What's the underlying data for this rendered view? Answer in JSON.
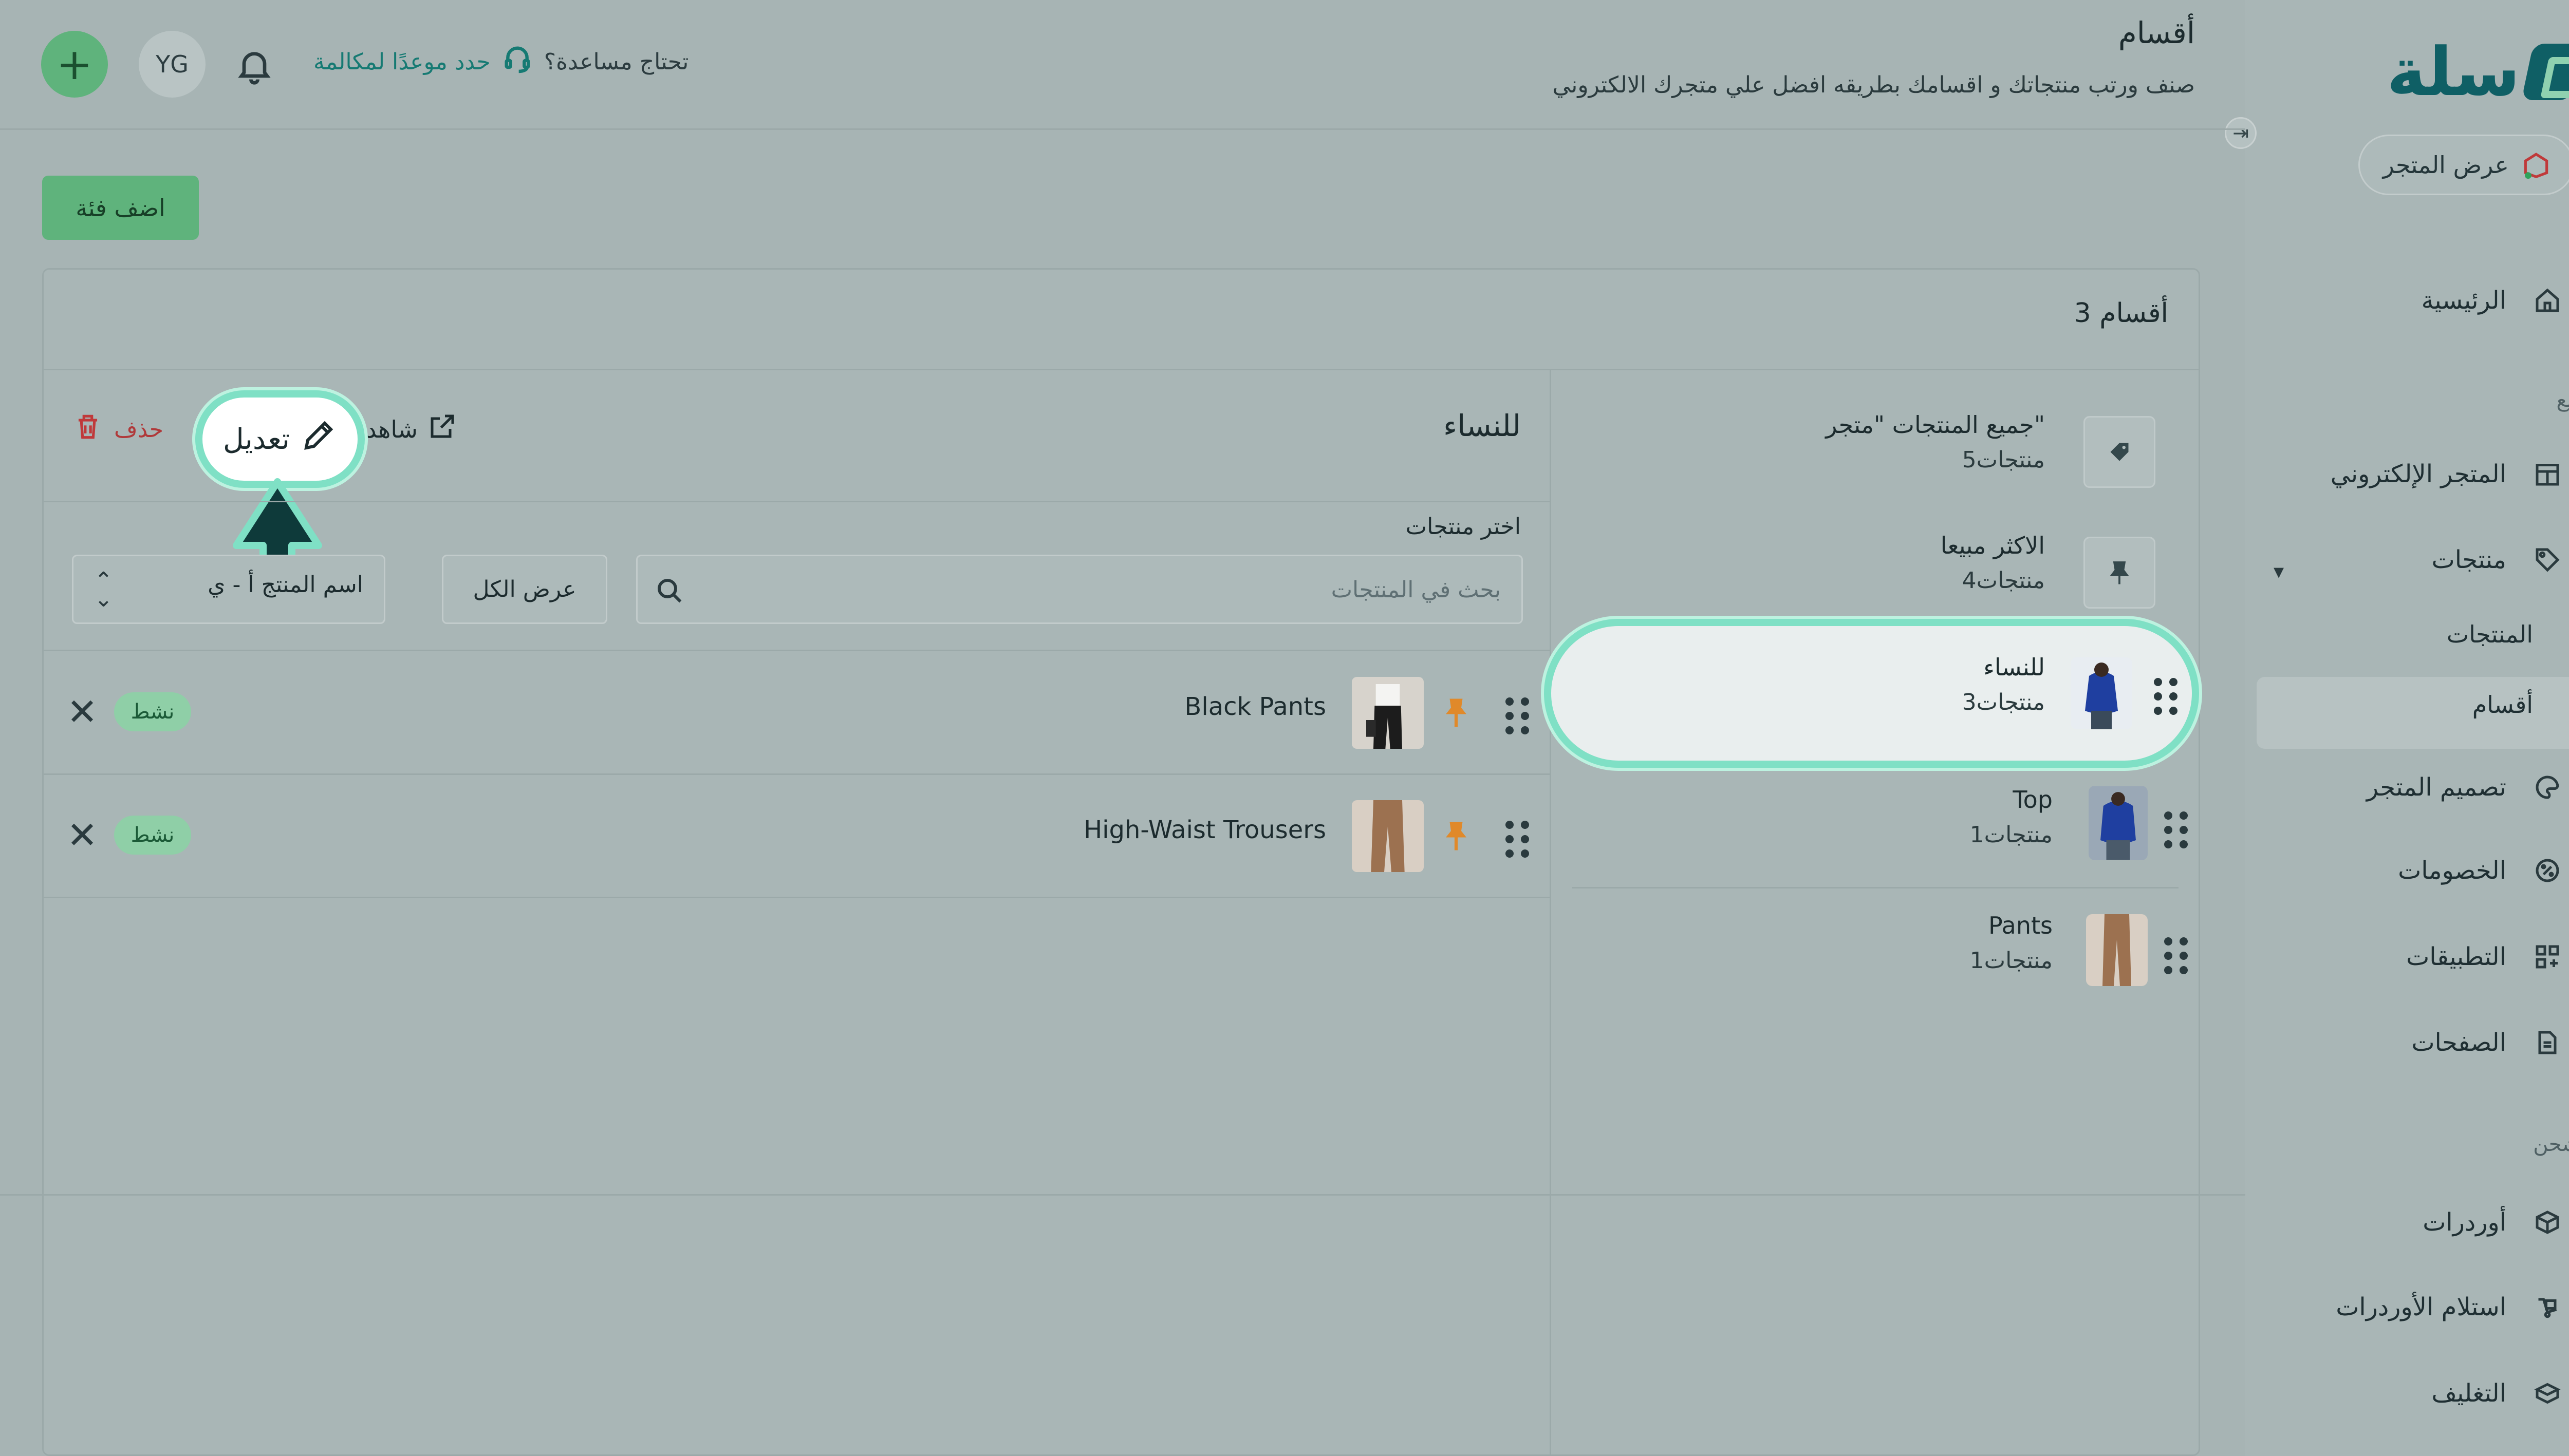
{
  "brand": {
    "name": "سلة"
  },
  "sidebar": {
    "store_button": "عرض المتجر",
    "items": [
      {
        "label": "الرئيسية",
        "icon": "home-icon"
      },
      {
        "section": "بيع"
      },
      {
        "label": "المتجر الإلكتروني",
        "icon": "storefront-icon"
      },
      {
        "label": "منتجات",
        "icon": "tag-icon"
      },
      {
        "sub": "المنتجات"
      },
      {
        "sub": "أقسام",
        "active": true
      },
      {
        "label": "تصميم المتجر",
        "icon": "palette-icon"
      },
      {
        "label": "الخصومات",
        "icon": "discount-icon"
      },
      {
        "label": "التطبيقات",
        "icon": "apps-icon"
      },
      {
        "label": "الصفحات",
        "icon": "pages-icon"
      },
      {
        "section": "شحن"
      },
      {
        "label": "أوردرات",
        "icon": "box-icon"
      },
      {
        "label": "استلام الأوردرات",
        "icon": "pickup-icon"
      },
      {
        "label": "التغليف",
        "icon": "package-icon"
      }
    ]
  },
  "header": {
    "title": "أقسام",
    "subtitle": "صنف ورتب منتجاتك و اقسامك بطريقه افضل علي متجرك الالكتروني",
    "help_question": "تحتاج مساعدة؟",
    "help_cta": "حدد موعدًا لمكالمة",
    "avatar_initials": "YG",
    "add_label": "+"
  },
  "toolbar": {
    "add_category": "اضف فئة"
  },
  "categories_panel": {
    "count_title": "3 أقسام",
    "items": [
      {
        "name": "جميع المنتجات \"متجر\"",
        "count": "5منتجات",
        "type": "icon",
        "icon": "tag-icon"
      },
      {
        "name": "الاكثر مبيعا",
        "count": "4منتجات",
        "type": "icon",
        "icon": "pin-icon"
      },
      {
        "name": "للنساء",
        "count": "3منتجات",
        "type": "thumb",
        "selected": true
      },
      {
        "name": "Top",
        "count": "1منتجات",
        "type": "thumb"
      },
      {
        "name": "Pants",
        "count": "1منتجات",
        "type": "thumb"
      }
    ]
  },
  "detail": {
    "title": "للنساء",
    "view_label": "شاهد",
    "edit_label": "تعديل",
    "delete_label": "حذف",
    "choose_products": "اختر منتجات",
    "search_placeholder": "بحث في المنتجات",
    "show_all": "عرض الكل",
    "sort_value": "اسم المنتج أ - ي",
    "products": [
      {
        "name": "Black Pants",
        "status": "نشط"
      },
      {
        "name": "High-Waist Trousers",
        "status": "نشط"
      }
    ]
  },
  "colors": {
    "brand": "#0f5f65",
    "accent_green": "#5fb37c",
    "highlight": "#7fe0c5",
    "danger": "#c0393a",
    "pin": "#e0892a"
  }
}
